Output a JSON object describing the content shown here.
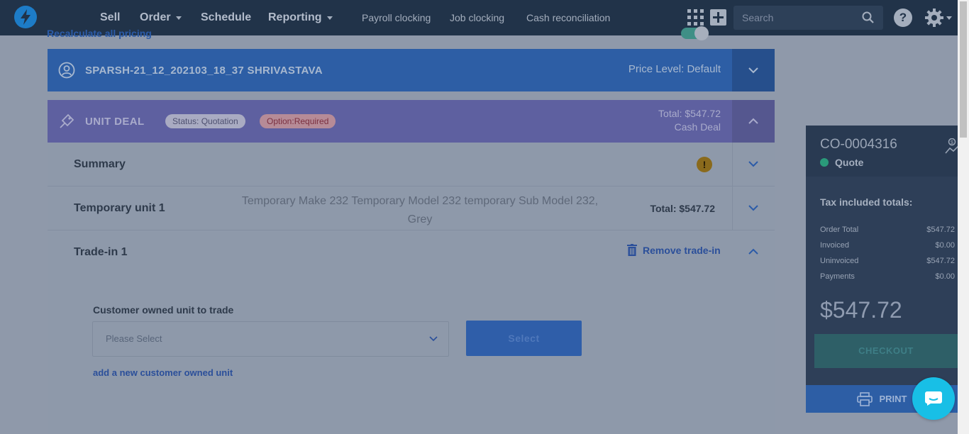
{
  "nav": {
    "main_items": [
      {
        "label": "Sell",
        "dropdown": false
      },
      {
        "label": "Order",
        "dropdown": true
      },
      {
        "label": "Schedule",
        "dropdown": false
      },
      {
        "label": "Reporting",
        "dropdown": true
      }
    ],
    "sub_items": [
      "Payroll clocking",
      "Job clocking",
      "Cash reconciliation"
    ],
    "search_placeholder": "Search",
    "help_label": "?"
  },
  "top_strip": {
    "recalc_label": "Recalculate all pricing"
  },
  "customer": {
    "name": "SPARSH-21_12_202103_18_37 SHRIVASTAVA",
    "price_level": "Price Level: Default"
  },
  "deal": {
    "title": "UNIT DEAL",
    "status_badge": "Status: Quotation",
    "option_badge": "Option:Required",
    "total": "Total: $547.72",
    "deal_type": "Cash Deal"
  },
  "summary": {
    "label": "Summary",
    "warning": "!"
  },
  "unit": {
    "label": "Temporary unit 1",
    "description": "Temporary Make 232 Temporary Model 232 temporary Sub Model 232, Grey",
    "total": "Total: $547.72"
  },
  "trade_in": {
    "label": "Trade-in 1",
    "remove_label": "Remove trade-in",
    "field_label": "Customer owned unit to trade",
    "select_placeholder": "Please Select",
    "select_button": "Select",
    "add_link": "add a new customer owned unit"
  },
  "order": {
    "id": "CO-0004316",
    "status": "Quote",
    "tax_title": "Tax included totals:",
    "rows": [
      {
        "label": "Order Total",
        "value": "$547.72"
      },
      {
        "label": "Invoiced",
        "value": "$0.00"
      },
      {
        "label": "Uninvoiced",
        "value": "$547.72"
      },
      {
        "label": "Payments",
        "value": "$0.00"
      }
    ],
    "big_total": "$547.72",
    "checkout_label": "CHECKOUT",
    "print_label": "PRINT"
  },
  "colors": {
    "nav_bg": "#213349",
    "customer_bar": "#2d5ea5",
    "deal_bar": "#5e60a0",
    "quote_dot": "#2a9a7a",
    "chat_fab": "#18bfe6"
  }
}
